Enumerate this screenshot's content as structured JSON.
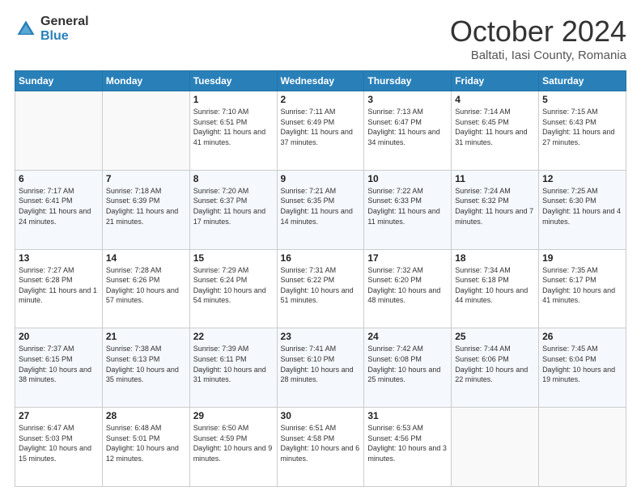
{
  "header": {
    "logo_general": "General",
    "logo_blue": "Blue",
    "month": "October 2024",
    "location": "Baltati, Iasi County, Romania"
  },
  "weekdays": [
    "Sunday",
    "Monday",
    "Tuesday",
    "Wednesday",
    "Thursday",
    "Friday",
    "Saturday"
  ],
  "weeks": [
    [
      {
        "day": "",
        "info": ""
      },
      {
        "day": "",
        "info": ""
      },
      {
        "day": "1",
        "info": "Sunrise: 7:10 AM\nSunset: 6:51 PM\nDaylight: 11 hours and 41 minutes."
      },
      {
        "day": "2",
        "info": "Sunrise: 7:11 AM\nSunset: 6:49 PM\nDaylight: 11 hours and 37 minutes."
      },
      {
        "day": "3",
        "info": "Sunrise: 7:13 AM\nSunset: 6:47 PM\nDaylight: 11 hours and 34 minutes."
      },
      {
        "day": "4",
        "info": "Sunrise: 7:14 AM\nSunset: 6:45 PM\nDaylight: 11 hours and 31 minutes."
      },
      {
        "day": "5",
        "info": "Sunrise: 7:15 AM\nSunset: 6:43 PM\nDaylight: 11 hours and 27 minutes."
      }
    ],
    [
      {
        "day": "6",
        "info": "Sunrise: 7:17 AM\nSunset: 6:41 PM\nDaylight: 11 hours and 24 minutes."
      },
      {
        "day": "7",
        "info": "Sunrise: 7:18 AM\nSunset: 6:39 PM\nDaylight: 11 hours and 21 minutes."
      },
      {
        "day": "8",
        "info": "Sunrise: 7:20 AM\nSunset: 6:37 PM\nDaylight: 11 hours and 17 minutes."
      },
      {
        "day": "9",
        "info": "Sunrise: 7:21 AM\nSunset: 6:35 PM\nDaylight: 11 hours and 14 minutes."
      },
      {
        "day": "10",
        "info": "Sunrise: 7:22 AM\nSunset: 6:33 PM\nDaylight: 11 hours and 11 minutes."
      },
      {
        "day": "11",
        "info": "Sunrise: 7:24 AM\nSunset: 6:32 PM\nDaylight: 11 hours and 7 minutes."
      },
      {
        "day": "12",
        "info": "Sunrise: 7:25 AM\nSunset: 6:30 PM\nDaylight: 11 hours and 4 minutes."
      }
    ],
    [
      {
        "day": "13",
        "info": "Sunrise: 7:27 AM\nSunset: 6:28 PM\nDaylight: 11 hours and 1 minute."
      },
      {
        "day": "14",
        "info": "Sunrise: 7:28 AM\nSunset: 6:26 PM\nDaylight: 10 hours and 57 minutes."
      },
      {
        "day": "15",
        "info": "Sunrise: 7:29 AM\nSunset: 6:24 PM\nDaylight: 10 hours and 54 minutes."
      },
      {
        "day": "16",
        "info": "Sunrise: 7:31 AM\nSunset: 6:22 PM\nDaylight: 10 hours and 51 minutes."
      },
      {
        "day": "17",
        "info": "Sunrise: 7:32 AM\nSunset: 6:20 PM\nDaylight: 10 hours and 48 minutes."
      },
      {
        "day": "18",
        "info": "Sunrise: 7:34 AM\nSunset: 6:18 PM\nDaylight: 10 hours and 44 minutes."
      },
      {
        "day": "19",
        "info": "Sunrise: 7:35 AM\nSunset: 6:17 PM\nDaylight: 10 hours and 41 minutes."
      }
    ],
    [
      {
        "day": "20",
        "info": "Sunrise: 7:37 AM\nSunset: 6:15 PM\nDaylight: 10 hours and 38 minutes."
      },
      {
        "day": "21",
        "info": "Sunrise: 7:38 AM\nSunset: 6:13 PM\nDaylight: 10 hours and 35 minutes."
      },
      {
        "day": "22",
        "info": "Sunrise: 7:39 AM\nSunset: 6:11 PM\nDaylight: 10 hours and 31 minutes."
      },
      {
        "day": "23",
        "info": "Sunrise: 7:41 AM\nSunset: 6:10 PM\nDaylight: 10 hours and 28 minutes."
      },
      {
        "day": "24",
        "info": "Sunrise: 7:42 AM\nSunset: 6:08 PM\nDaylight: 10 hours and 25 minutes."
      },
      {
        "day": "25",
        "info": "Sunrise: 7:44 AM\nSunset: 6:06 PM\nDaylight: 10 hours and 22 minutes."
      },
      {
        "day": "26",
        "info": "Sunrise: 7:45 AM\nSunset: 6:04 PM\nDaylight: 10 hours and 19 minutes."
      }
    ],
    [
      {
        "day": "27",
        "info": "Sunrise: 6:47 AM\nSunset: 5:03 PM\nDaylight: 10 hours and 15 minutes."
      },
      {
        "day": "28",
        "info": "Sunrise: 6:48 AM\nSunset: 5:01 PM\nDaylight: 10 hours and 12 minutes."
      },
      {
        "day": "29",
        "info": "Sunrise: 6:50 AM\nSunset: 4:59 PM\nDaylight: 10 hours and 9 minutes."
      },
      {
        "day": "30",
        "info": "Sunrise: 6:51 AM\nSunset: 4:58 PM\nDaylight: 10 hours and 6 minutes."
      },
      {
        "day": "31",
        "info": "Sunrise: 6:53 AM\nSunset: 4:56 PM\nDaylight: 10 hours and 3 minutes."
      },
      {
        "day": "",
        "info": ""
      },
      {
        "day": "",
        "info": ""
      }
    ]
  ]
}
